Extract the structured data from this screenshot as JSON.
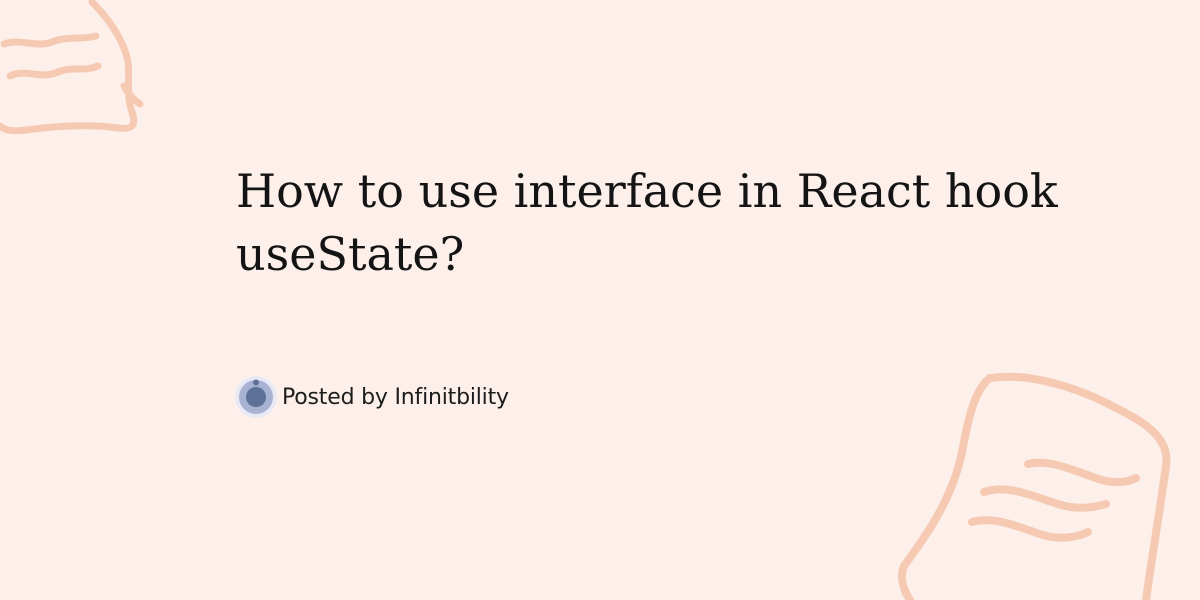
{
  "post": {
    "title": "How to use interface in React hook useState?",
    "byline": "Posted by Infinitbility"
  },
  "icons": {
    "avatar": "infinitbility-logo-icon",
    "decorations": "scribble-note-icon"
  },
  "colors": {
    "background": "#fdf0eb",
    "decoration": "#f6c9b3",
    "avatar": "#5d7296",
    "title": "#141414"
  }
}
